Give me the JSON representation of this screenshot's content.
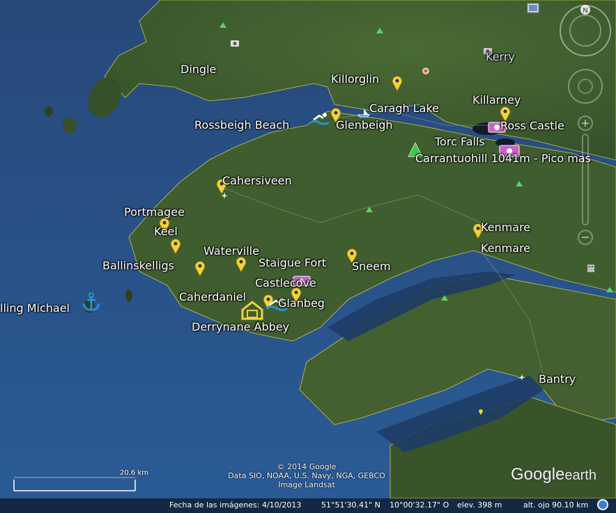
{
  "places": [
    {
      "id": "dingle",
      "label": "Dingle"
    },
    {
      "id": "kerry",
      "label": "Kerry"
    },
    {
      "id": "killorglin",
      "label": "Killorglin"
    },
    {
      "id": "caragh-lake",
      "label": "Caragh Lake"
    },
    {
      "id": "killarney",
      "label": "Killarney"
    },
    {
      "id": "rossbeigh-beach",
      "label": "Rossbeigh Beach"
    },
    {
      "id": "glenbeigh",
      "label": "Glenbeigh"
    },
    {
      "id": "ross-castle",
      "label": "Ross Castle"
    },
    {
      "id": "torc-falls",
      "label": "Torc Falls"
    },
    {
      "id": "carrantuohill",
      "label": "Carrantuohill 1041m - Pico mas"
    },
    {
      "id": "cahersiveen",
      "label": "Cahersiveen"
    },
    {
      "id": "portmagee",
      "label": "Portmagee"
    },
    {
      "id": "keel",
      "label": "Keel"
    },
    {
      "id": "kenmare-1",
      "label": "Kenmare"
    },
    {
      "id": "kenmare-2",
      "label": "Kenmare"
    },
    {
      "id": "waterville",
      "label": "Waterville"
    },
    {
      "id": "ballinskelligs",
      "label": "Ballinskelligs"
    },
    {
      "id": "staigue-fort",
      "label": "Staigue Fort"
    },
    {
      "id": "sneem",
      "label": "Sneem"
    },
    {
      "id": "castlecove",
      "label": "Castlecove"
    },
    {
      "id": "skellig-michael",
      "label": "lling Michael"
    },
    {
      "id": "caherdaniel",
      "label": "Caherdaniel"
    },
    {
      "id": "glanbeg",
      "label": "Glanbeg"
    },
    {
      "id": "derrynane-abbey",
      "label": "Derrynane Abbey"
    },
    {
      "id": "bantry",
      "label": "Bantry"
    }
  ],
  "attribution": {
    "line1": "© 2014 Google",
    "line2": "Data SIO, NOAA, U.S. Navy, NGA, GEBCO",
    "line3": "Image Landsat"
  },
  "brand": {
    "google": "Google",
    "earth": "earth"
  },
  "scale": {
    "label": "20.6 km"
  },
  "status": {
    "imagery_date": "Fecha de las imágenes: 4/10/2013",
    "latitude": "51°51'30.41\" N",
    "longitude": "10°00'32.17\" O",
    "elevation": "elev.   398 m",
    "eye_altitude": "alt. ojo  90.10 km"
  },
  "colors": {
    "sea": "#1d3f6e",
    "land": "#3d5a2c",
    "pin": "#f2d33a",
    "poi": "#c860c8",
    "water_icon": "#2a8fe0"
  }
}
